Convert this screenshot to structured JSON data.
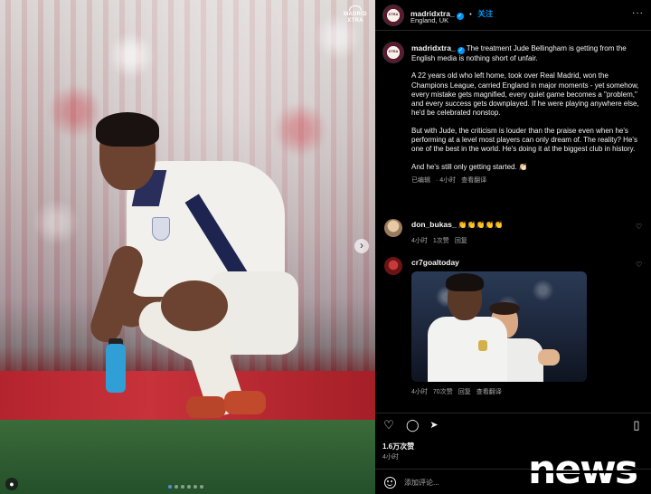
{
  "media": {
    "watermark_logo_lines": [
      "MADRID",
      "XTRA"
    ],
    "next_arrow": "›",
    "slide_count": 6,
    "active_slide": 1
  },
  "header": {
    "avatar_text": "XTRA",
    "username": "madridxtra_",
    "verified_mark": "✓",
    "separator": "•",
    "follow_label": "关注",
    "location": "England, UK",
    "more": "···"
  },
  "caption": {
    "username": "madridxtra_",
    "verified_mark": "✓",
    "lead": "The treatment Jude Bellingham is getting from the English media is nothing short of unfair.",
    "para2": "A 22 years old who left home, took over Real Madrid, won the Champions League, carried England in major moments - yet somehow, every mistake gets magnified, every quiet game becomes a \"problem,\" and every success gets downplayed. If he were playing anywhere else, he'd be celebrated nonstop.",
    "para3": "But with Jude, the criticism is louder than the praise even when he's performing at a level most players can only dream of. The reality? He's one of the best in the world. He's doing it at the biggest club in history.",
    "para4": "And he's still only getting started. 👏🏻",
    "meta": [
      "已编辑",
      "· 4小时",
      "查看翻译"
    ]
  },
  "comments": [
    {
      "username": "don_bukas_",
      "text": "👏👏👏👏👏",
      "meta": [
        "4小时",
        "1次赞",
        "回复"
      ],
      "heart": "♡"
    },
    {
      "username": "cr7goaltoday",
      "text": "",
      "meta": [
        "4小时",
        "70次赞",
        "回复",
        "查看翻译"
      ],
      "heart": "♡"
    }
  ],
  "actions": {
    "like_icon": "♡",
    "comment_icon": "◯",
    "share_icon": "➤",
    "save_icon": "▯"
  },
  "likes": "1.6万次赞",
  "time": "4小时",
  "add_comment": {
    "placeholder": "添加评论..."
  },
  "watermark_news": "news"
}
